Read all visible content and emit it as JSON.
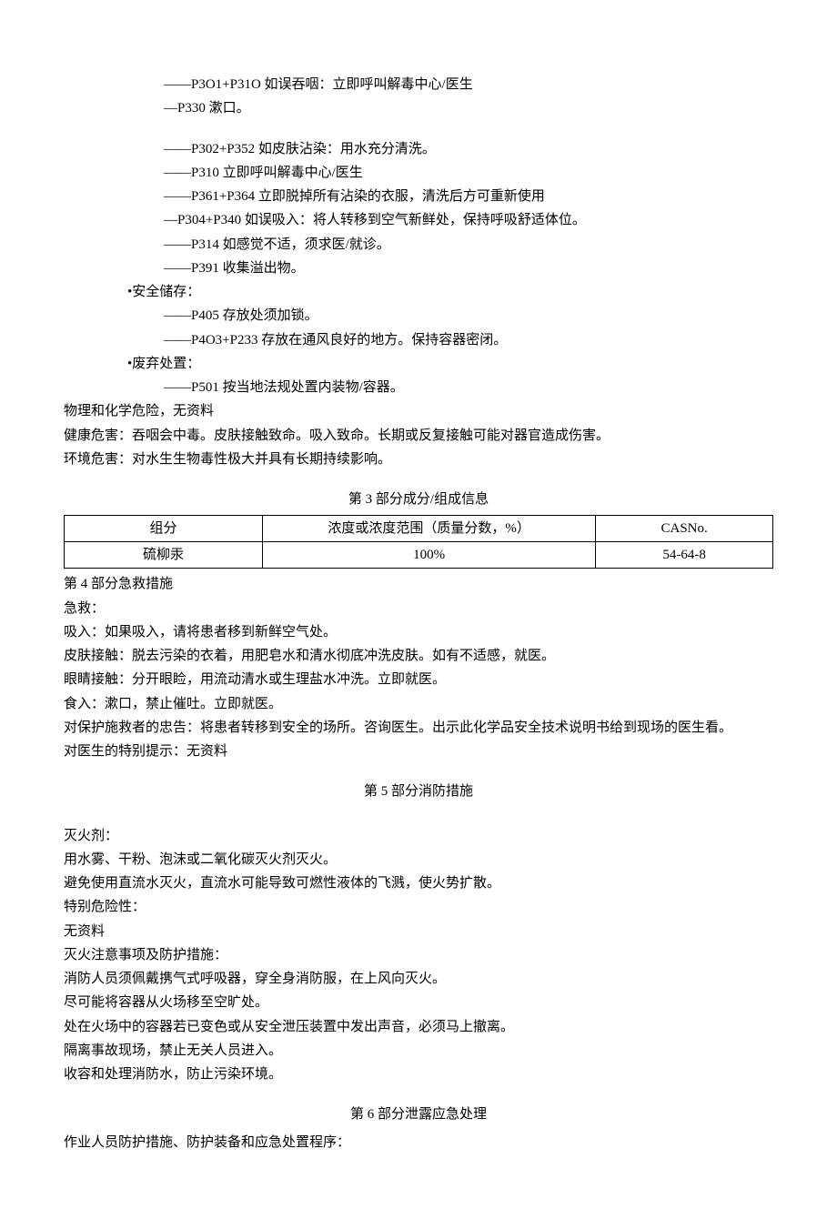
{
  "precaution_lines": [
    "——P3O1+P31O 如误吞咽：立即呼叫解毒中心/医生",
    "—P330 漱口。",
    "——P302+P352 如皮肤沾染：用水充分清洗。",
    "——P310 立即呼叫解毒中心/医生",
    "——P361+P364 立即脱掉所有沾染的衣服，清洗后方可重新使用",
    "—P304+P340 如误吸入：将人转移到空气新鲜处，保持呼吸舒适体位。",
    "——P314 如感觉不适，须求医/就诊。",
    "——P391 收集溢出物。"
  ],
  "storage_header": "•安全储存：",
  "storage_lines": [
    "——P405 存放处须加锁。",
    "——P4O3+P233 存放在通风良好的地方。保持容器密闭。"
  ],
  "disposal_header": "•废弃处置：",
  "disposal_lines": [
    "——P501 按当地法规处置内装物/容器。"
  ],
  "hazard_physical": "物理和化学危险，无资料",
  "hazard_health": "健康危害：吞咽会中毒。皮肤接触致命。吸入致命。长期或反复接触可能对器官造成伤害。",
  "hazard_env": "环境危害：对水生生物毒性极大并具有长期持续影响。",
  "section3": {
    "heading": "第 3 部分成分/组成信息",
    "headers": [
      "组分",
      "浓度或浓度范围（质量分数，%）",
      "CASNo."
    ],
    "row": [
      "硫柳汞",
      "100%",
      "54-64-8"
    ]
  },
  "section4": {
    "heading": "第 4 部分急救措施",
    "lines": [
      "急救：",
      "吸入：如果吸入，请将患者移到新鲜空气处。",
      "皮肤接触：脱去污染的衣着，用肥皂水和清水彻底冲洗皮肤。如有不适感，就医。",
      "眼睛接触：分开眼睑，用流动清水或生理盐水冲洗。立即就医。",
      "食入：漱口，禁止催吐。立即就医。",
      "对保护施救者的忠告：将患者转移到安全的场所。咨询医生。出示此化学品安全技术说明书给到现场的医生看。",
      "对医生的特别提示：无资料"
    ]
  },
  "section5": {
    "heading": "第 5 部分消防措施",
    "lines": [
      "灭火剂：",
      "用水雾、干粉、泡沫或二氧化碳灭火剂灭火。",
      "避免使用直流水灭火，直流水可能导致可燃性液体的飞溅，使火势扩散。",
      "特别危险性：",
      "无资料",
      "灭火注意事项及防护措施：",
      "消防人员须佩戴携气式呼吸器，穿全身消防服，在上风向灭火。",
      "尽可能将容器从火场移至空旷处。",
      "处在火场中的容器若已变色或从安全泄压装置中发出声音，必须马上撤离。",
      "隔离事故现场，禁止无关人员进入。",
      "收容和处理消防水，防止污染环境。"
    ]
  },
  "section6": {
    "heading": "第 6 部分泄露应急处理",
    "lines": [
      "作业人员防护措施、防护装备和应急处置程序："
    ]
  }
}
